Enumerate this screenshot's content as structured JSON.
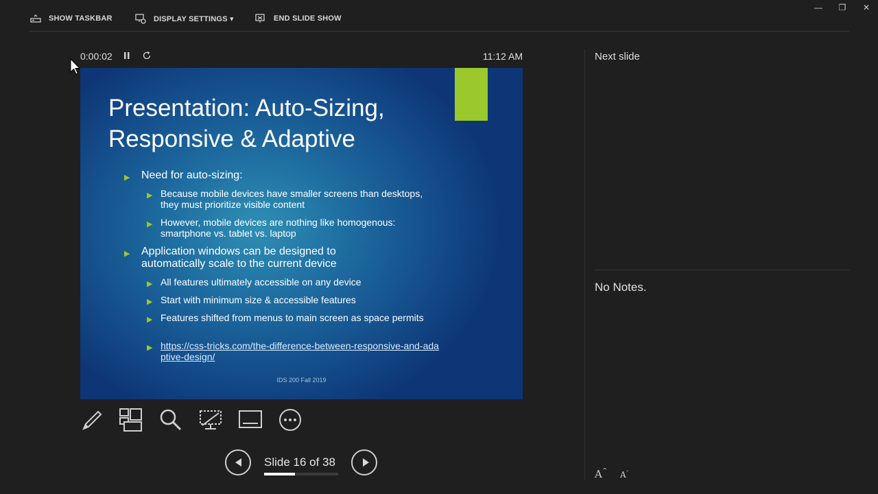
{
  "toolbar": {
    "show_taskbar": "SHOW TASKBAR",
    "display_settings": "DISPLAY SETTINGS ▾",
    "end_slide_show": "END SLIDE SHOW"
  },
  "window_controls": {
    "minimize": "—",
    "restore": "❐",
    "close": "✕"
  },
  "timer": {
    "elapsed": "0:00:02",
    "clock": "11:12 AM"
  },
  "slide": {
    "title_line1": "Presentation: Auto-Sizing,",
    "title_line2": "Responsive & Adaptive",
    "bullets": [
      "Need for auto-sizing:",
      "Because mobile devices have smaller screens than desktops, they must prioritize visible content",
      "However, mobile devices are nothing like homogenous: smartphone vs. tablet vs. laptop",
      "Application windows can be designed to automatically scale to the current device",
      "All features ultimately accessible on any device",
      "Start with minimum size & accessible features",
      "Features shifted from menus to main screen as space permits",
      "https://css-tricks.com/the-difference-between-responsive-and-adaptive-design/"
    ],
    "footer": "IDS 200 Fall 2019",
    "accent_color": "#9bc82c"
  },
  "tools": [
    "pen-icon",
    "see-all-slides-icon",
    "zoom-icon",
    "black-screen-icon",
    "subtitles-icon",
    "more-options-icon"
  ],
  "navigation": {
    "slide_label": "Slide 16 of 38",
    "current": 16,
    "total": 38,
    "progress_fraction": 0.42
  },
  "right_pane": {
    "next_slide_label": "Next slide",
    "notes": "No Notes.",
    "font_increase": "A",
    "font_decrease": "A"
  }
}
